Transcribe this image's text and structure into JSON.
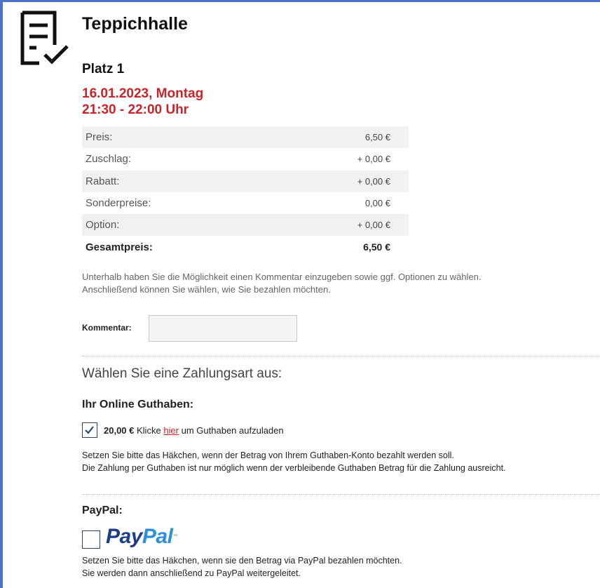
{
  "booking": {
    "title": "Teppichhalle",
    "court": "Platz 1",
    "date": "16.01.2023, Montag",
    "time": "21:30 - 22:00 Uhr"
  },
  "price_table": [
    {
      "label": "Preis:",
      "value": "6,50 €"
    },
    {
      "label": "Zuschlag:",
      "value": "+ 0,00 €"
    },
    {
      "label": "Rabatt:",
      "value": "+ 0,00 €"
    },
    {
      "label": "Sonderpreise:",
      "value": "0,00 €"
    },
    {
      "label": "Option:",
      "value": "+ 0,00 €"
    },
    {
      "label": "Gesamtpreis:",
      "value": "6,50 €"
    }
  ],
  "hint": {
    "line1": "Unterhalb haben Sie die Möglichkeit einen Kommentar einzugeben sowie ggf. Optionen zu wählen.",
    "line2": "Anschließend können Sie wählen, wie Sie bezahlen möchten."
  },
  "comment": {
    "label": "Kommentar:",
    "value": "",
    "placeholder": ""
  },
  "payment": {
    "heading": "Wählen Sie eine Zahlungsart aus:",
    "credit": {
      "heading": "Ihr Online Guthaben:",
      "checked": true,
      "amount": "20,00 €",
      "text_before": "Klicke",
      "link": "hier",
      "text_after": "um Guthaben aufzuladen",
      "note_line1": "Setzen Sie bitte das Häkchen, wenn der Betrag von Ihrem Guthaben-Konto bezahlt werden soll.",
      "note_line2": "Die Zahlung per Guthaben ist nur möglich wenn der verbleibende Guthaben Betrag für die Zahlung ausreicht."
    },
    "paypal": {
      "heading": "PayPal:",
      "checked": false,
      "logo_pay": "Pay",
      "logo_pal": "Pal",
      "logo_tm": "™",
      "note_line1": "Setzen Sie bitte das Häkchen, wenn sie den Betrag via PayPal bezahlen möchten.",
      "note_line2": "Sie werden dann anschließend zu PayPal weitergeleitet."
    }
  },
  "icons": {
    "header": "checklist-icon",
    "credit_checkbox": "checkmark-icon"
  },
  "colors": {
    "accent_red": "#c8242a",
    "frame_blue": "#4a74c9",
    "paypal_dark": "#1c3d87",
    "paypal_light": "#2c8fd8"
  }
}
